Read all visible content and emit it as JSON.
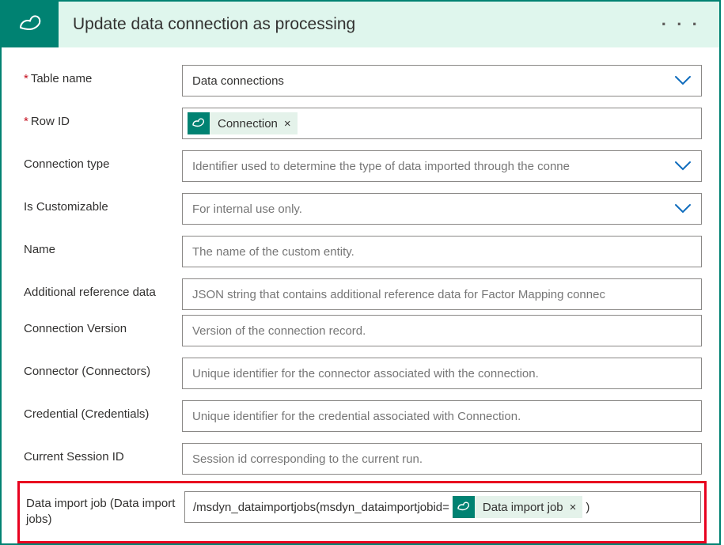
{
  "header": {
    "title": "Update data connection as processing"
  },
  "fields": {
    "table_name": {
      "label": "Table name",
      "value": "Data connections",
      "required": true
    },
    "row_id": {
      "label": "Row ID",
      "required": true,
      "token": "Connection"
    },
    "connection_type": {
      "label": "Connection type",
      "placeholder": "Identifier used to determine the type of data imported through the conne"
    },
    "is_customizable": {
      "label": "Is Customizable",
      "placeholder": "For internal use only."
    },
    "name": {
      "label": "Name",
      "placeholder": "The name of the custom entity."
    },
    "additional_ref": {
      "label": "Additional reference data",
      "placeholder": "JSON string that contains additional reference data for Factor Mapping connec"
    },
    "connection_version": {
      "label": "Connection Version",
      "placeholder": "Version of the connection record."
    },
    "connector": {
      "label": "Connector (Connectors)",
      "placeholder": "Unique identifier for the connector associated with the connection."
    },
    "credential": {
      "label": "Credential (Credentials)",
      "placeholder": "Unique identifier for the credential associated with Connection."
    },
    "session_id": {
      "label": "Current Session ID",
      "placeholder": "Session id corresponding to the current run."
    },
    "data_import_job": {
      "label": "Data import job (Data import jobs)",
      "prefix": "/msdyn_dataimportjobs(msdyn_dataimportjobid=",
      "token": "Data import job",
      "suffix": ")"
    }
  }
}
